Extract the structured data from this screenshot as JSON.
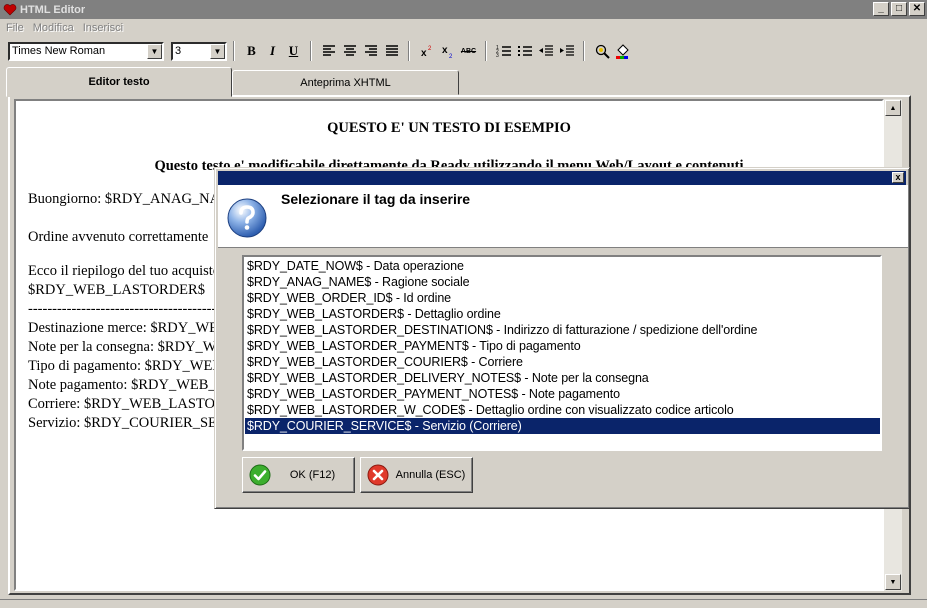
{
  "window": {
    "title": "HTML Editor",
    "minimize": "_",
    "maximize": "□",
    "close": "✕"
  },
  "menu": [
    "File",
    "Modifica",
    "Inserisci"
  ],
  "toolbar": {
    "font_name": "Times New Roman",
    "font_size": "3",
    "bold": "B",
    "italic": "I",
    "underline": "U",
    "spellcheck": "ABC"
  },
  "tabs": [
    {
      "label": "Editor testo",
      "active": true
    },
    {
      "label": "Anteprima XHTML",
      "active": false
    }
  ],
  "editor": {
    "lines": [
      "QUESTO E' UN TESTO DI ESEMPIO",
      "Questo testo e' modificabile direttamente da Ready utilizzando il menu Web/Layout e contenuti",
      "Buongiorno: $RDY_ANAG_NAME$",
      "Ordine avvenuto correttamente",
      "Ecco il riepilogo del tuo acquisto",
      "$RDY_WEB_LASTORDER$",
      "----------------------------------------",
      "Destinazione merce: $RDY_WEB_LASTORDER_DESTINATION$",
      "Note per la consegna: $RDY_WEB_LASTORDER_DELIVERY_NOTES$",
      "Tipo di pagamento: $RDY_WEB_LASTORDER_PAYMENT$",
      "Note pagamento: $RDY_WEB_LASTORDER_PAYMENT_NOTES$",
      "Corriere: $RDY_WEB_LASTORDER_COURIER$",
      "Servizio: $RDY_COURIER_SERVICE$"
    ]
  },
  "dialog": {
    "close": "x",
    "heading": "Selezionare il tag da inserire",
    "items": [
      "$RDY_DATE_NOW$ - Data operazione",
      "$RDY_ANAG_NAME$ - Ragione sociale",
      "$RDY_WEB_ORDER_ID$ - Id ordine",
      "$RDY_WEB_LASTORDER$ - Dettaglio ordine",
      "$RDY_WEB_LASTORDER_DESTINATION$ - Indirizzo di fatturazione / spedizione dell'ordine",
      "$RDY_WEB_LASTORDER_PAYMENT$ - Tipo di pagamento",
      "$RDY_WEB_LASTORDER_COURIER$ - Corriere",
      "$RDY_WEB_LASTORDER_DELIVERY_NOTES$ - Note per la consegna",
      "$RDY_WEB_LASTORDER_PAYMENT_NOTES$ - Note pagamento",
      "$RDY_WEB_LASTORDER_W_CODE$ - Dettaglio ordine con visualizzato codice articolo",
      "$RDY_COURIER_SERVICE$ - Servizio (Corriere)"
    ],
    "selected_index": 10,
    "ok_label": "OK (F12)",
    "cancel_label": "Annulla (ESC)"
  },
  "colors": {
    "selection": "#0a246a",
    "dialog_title": "#0a246a",
    "window_title": "#808080",
    "face": "#d4d0c8"
  }
}
